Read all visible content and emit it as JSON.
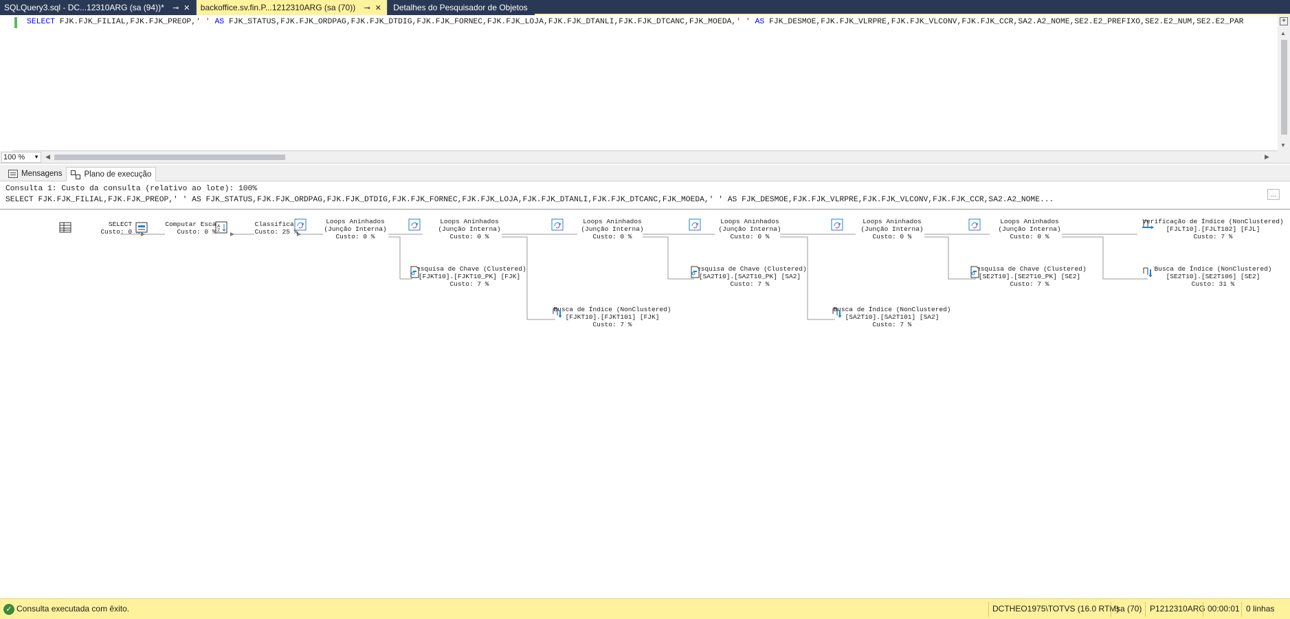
{
  "tabs": [
    {
      "title": "SQLQuery3.sql - DC...12310ARG (sa (94))*",
      "active": false
    },
    {
      "title": "backoffice.sv.fin.P...1212310ARG (sa (70))",
      "active": true
    },
    {
      "title": "Detalhes do Pesquisador de Objetos",
      "active": false
    }
  ],
  "editor": {
    "sql_select": "SELECT",
    "sql_part1": " FJK.FJK_FILIAL,FJK.FJK_PREOP,",
    "sql_str1": "' '",
    "sql_as1": " AS",
    "sql_part2": " FJK_STATUS,FJK.FJK_ORDPAG,FJK.FJK_DTDIG,FJK.FJK_FORNEC,FJK.FJK_LOJA,FJK.FJK_DTANLI,FJK.FJK_DTCANC,FJK_MOEDA,",
    "sql_str2": "' '",
    "sql_as2": " AS",
    "sql_part3": " FJK_DESMOE,FJK.FJK_VLRPRE,FJK.FJK_VLCONV,FJK.FJK_CCR,SA2.A2_NOME,SE2.E2_PREFIXO,SE2.E2_NUM,SE2.E2_PAR"
  },
  "zoom": {
    "value": "100 %"
  },
  "result_tabs": {
    "messages": "Mensagens",
    "plan": "Plano de execução"
  },
  "query_header": {
    "line1": "Consulta 1: Custo da consulta (relativo ao lote): 100%",
    "line2": "SELECT FJK.FJK_FILIAL,FJK.FJK_PREOP,' ' AS FJK_STATUS,FJK.FJK_ORDPAG,FJK.FJK_DTDIG,FJK.FJK_FORNEC,FJK.FJK_LOJA,FJK.FJK_DTANLI,FJK.FJK_DTCANC,FJK_MOEDA,' ' AS FJK_DESMOE,FJK.FJK_VLRPRE,FJK.FJK_VLCONV,FJK.FJK_CCR,SA2.A2_NOME...",
    "more": "..."
  },
  "plan_nodes": [
    {
      "id": "select",
      "icon": "select-icon",
      "lines": [
        "SELECT",
        "Custo: 0 %"
      ]
    },
    {
      "id": "compute",
      "icon": "compute-scalar-icon",
      "lines": [
        "Computar Escalar",
        "Custo: 0 %"
      ]
    },
    {
      "id": "sort",
      "icon": "sort-icon",
      "lines": [
        "Classificar",
        "Custo: 25 %"
      ]
    },
    {
      "id": "loop1",
      "icon": "nested-loops-icon",
      "lines": [
        "Loops Aninhados",
        "(Junção Interna)",
        "Custo: 0 %"
      ]
    },
    {
      "id": "loop2",
      "icon": "nested-loops-icon",
      "lines": [
        "Loops Aninhados",
        "(Junção Interna)",
        "Custo: 0 %"
      ]
    },
    {
      "id": "keylookup1",
      "icon": "key-lookup-icon",
      "lines": [
        "Pesquisa de Chave (Clustered)",
        "[FJKT10].[FJKT10_PK] [FJK]",
        "Custo: 7 %"
      ]
    },
    {
      "id": "loop3",
      "icon": "nested-loops-icon",
      "lines": [
        "Loops Aninhados",
        "(Junção Interna)",
        "Custo: 0 %"
      ]
    },
    {
      "id": "seek1",
      "icon": "index-seek-icon",
      "lines": [
        "Busca de Índice (NonClustered)",
        "[FJKT10].[FJKT101] [FJK]",
        "Custo: 7 %"
      ]
    },
    {
      "id": "loop4",
      "icon": "nested-loops-icon",
      "lines": [
        "Loops Aninhados",
        "(Junção Interna)",
        "Custo: 0 %"
      ]
    },
    {
      "id": "keylookup2",
      "icon": "key-lookup-icon",
      "lines": [
        "Pesquisa de Chave (Clustered)",
        "[SA2T10].[SA2T10_PK] [SA2]",
        "Custo: 7 %"
      ]
    },
    {
      "id": "loop5",
      "icon": "nested-loops-icon",
      "lines": [
        "Loops Aninhados",
        "(Junção Interna)",
        "Custo: 0 %"
      ]
    },
    {
      "id": "seek2",
      "icon": "index-seek-icon",
      "lines": [
        "Busca de Índice (NonClustered)",
        "[SA2T10].[SA2T101] [SA2]",
        "Custo: 7 %"
      ]
    },
    {
      "id": "loop6",
      "icon": "nested-loops-icon",
      "lines": [
        "Loops Aninhados",
        "(Junção Interna)",
        "Custo: 0 %"
      ]
    },
    {
      "id": "keylookup3",
      "icon": "key-lookup-icon",
      "lines": [
        "Pesquisa de Chave (Clustered)",
        "[SE2T10].[SE2T10_PK] [SE2]",
        "Custo: 7 %"
      ]
    },
    {
      "id": "scan1",
      "icon": "index-scan-icon",
      "lines": [
        "Verificação de Índice (NonClustered)",
        "[FJLT10].[FJLT102] [FJL]",
        "Custo: 7 %"
      ]
    },
    {
      "id": "seek3",
      "icon": "index-seek-icon",
      "lines": [
        "Busca de Índice (NonClustered)",
        "[SE2T10].[SE2T106] [SE2]",
        "Custo: 31 %"
      ]
    }
  ],
  "status": {
    "message": "Consulta executada com êxito.",
    "server": "DCTHEO1975\\TOTVS (16.0 RTM)",
    "user": "sa (70)",
    "database": "P1212310ARG",
    "time": "00:00:01",
    "rows": "0 linhas"
  },
  "colors": {
    "tabbar": "#293955",
    "active_tab": "#fff29d",
    "status_bar": "#fff29d",
    "keyword": "#0000ff",
    "string": "#ff0000",
    "icon_accent": "#1e7fd8"
  }
}
